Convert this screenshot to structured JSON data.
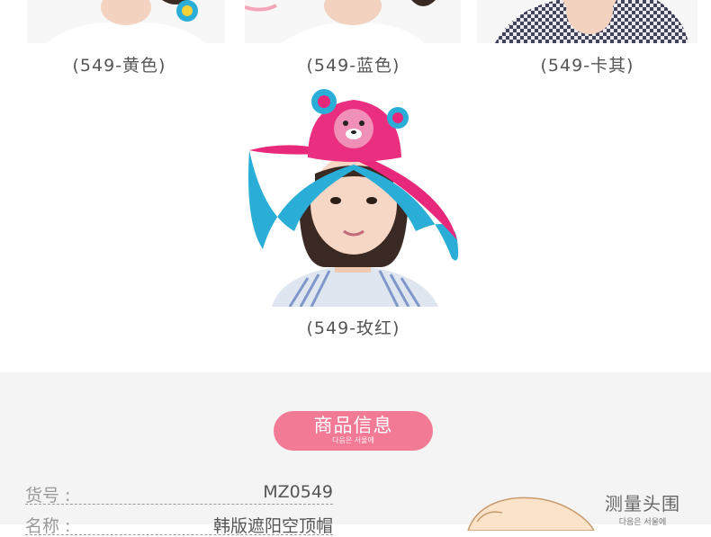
{
  "products": [
    {
      "caption": "(549-黄色)"
    },
    {
      "caption": "(549-蓝色)"
    },
    {
      "caption": "(549-卡其)"
    },
    {
      "caption": "(549-玫红)"
    }
  ],
  "info": {
    "header_title": "商品信息",
    "header_sub": "다음은 서울에",
    "rows": [
      {
        "label": "货号 :",
        "value": "MZ0549"
      },
      {
        "label": "名称 :",
        "value": "韩版遮阳空顶帽"
      }
    ]
  },
  "measure": {
    "title": "测量头围",
    "sub": "다음은 서울에"
  },
  "colors": {
    "pill": "#f27a95",
    "hat_pink": "#e8287a",
    "hat_blue": "#2aaed8"
  }
}
